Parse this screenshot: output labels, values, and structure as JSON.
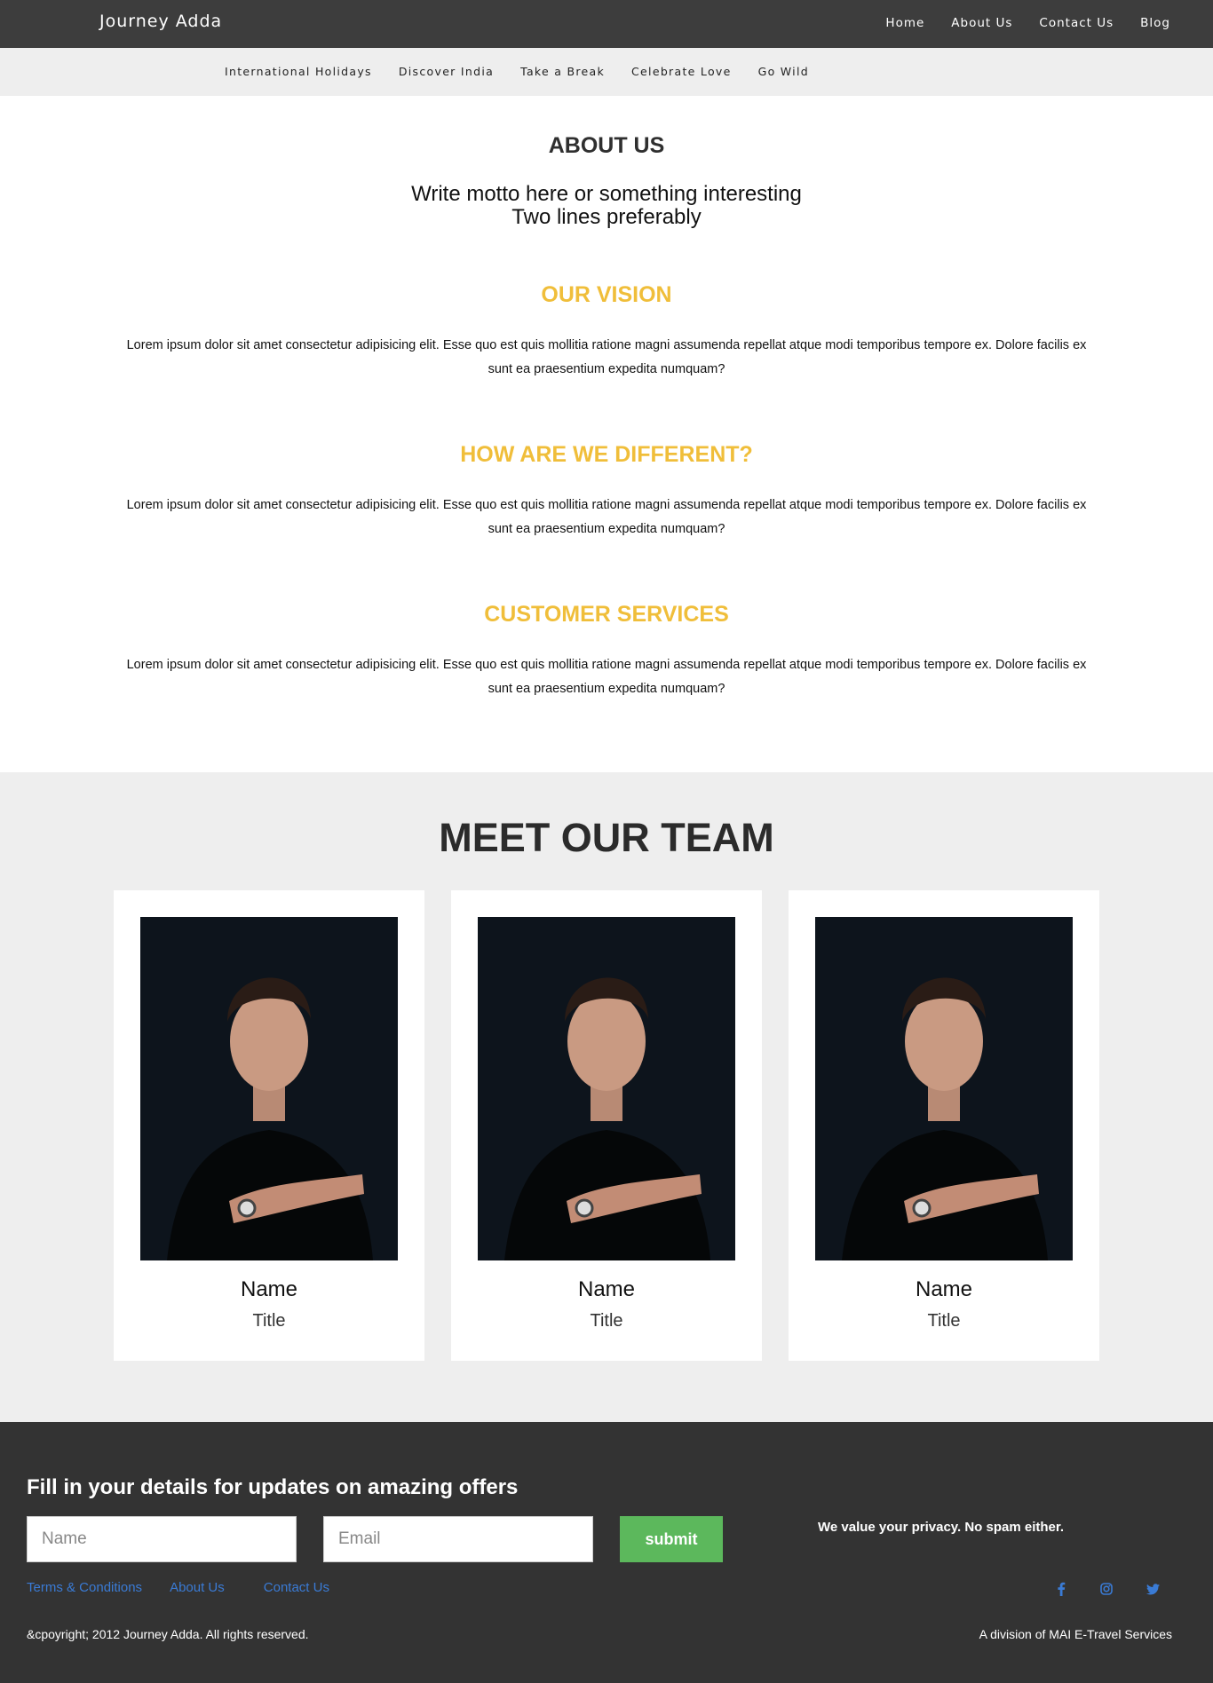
{
  "header": {
    "brand": "Journey Adda",
    "nav": [
      "Home",
      "About Us",
      "Contact Us",
      "Blog"
    ]
  },
  "subnav": [
    "International Holidays",
    "Discover India",
    "Take a Break",
    "Celebrate Love",
    "Go Wild"
  ],
  "about": {
    "title": "ABOUT US",
    "motto_line1": "Write motto here or something interesting",
    "motto_line2": "Two lines preferably",
    "sections": [
      {
        "heading": "OUR VISION",
        "body": "Lorem ipsum dolor sit amet consectetur adipisicing elit. Esse quo est quis mollitia ratione magni assumenda repellat atque modi temporibus tempore ex. Dolore facilis ex sunt ea praesentium expedita numquam?"
      },
      {
        "heading": "HOW ARE WE DIFFERENT?",
        "body": "Lorem ipsum dolor sit amet consectetur adipisicing elit. Esse quo est quis mollitia ratione magni assumenda repellat atque modi temporibus tempore ex. Dolore facilis ex sunt ea praesentium expedita numquam?"
      },
      {
        "heading": "CUSTOMER SERVICES",
        "body": "Lorem ipsum dolor sit amet consectetur adipisicing elit. Esse quo est quis mollitia ratione magni assumenda repellat atque modi temporibus tempore ex. Dolore facilis ex sunt ea praesentium expedita numquam?"
      }
    ]
  },
  "team": {
    "title": "MEET OUR TEAM",
    "members": [
      {
        "name": "Name",
        "title": "Title"
      },
      {
        "name": "Name",
        "title": "Title"
      },
      {
        "name": "Name",
        "title": "Title"
      }
    ]
  },
  "footer": {
    "heading": "Fill in your details for updates on amazing offers",
    "name_placeholder": "Name",
    "email_placeholder": "Email",
    "submit_label": "submit",
    "privacy": "We value your privacy. No spam either.",
    "links": [
      "Terms & Conditions",
      "About Us",
      "Contact Us"
    ],
    "social_icons": [
      "facebook-icon",
      "instagram-icon",
      "twitter-icon"
    ],
    "copyright": "&cpoyright; 2012 Journey Adda. All rights reserved.",
    "division": "A division of MAI E-Travel Services"
  },
  "colors": {
    "topbar": "#3d3d3d",
    "accent_heading": "#f0be3a",
    "submit_button": "#5cb85c",
    "footer_link": "#3a7bd5",
    "footer_bg": "#333333"
  }
}
